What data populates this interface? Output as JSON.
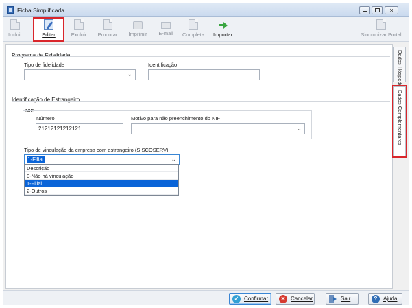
{
  "window": {
    "title": "Ficha Simplificada"
  },
  "toolbar": {
    "incluir": "Incluir",
    "editar": "Editar",
    "excluir": "Excluir",
    "procurar": "Procurar",
    "imprimir": "Imprimir",
    "email": "E-mail",
    "completa": "Completa",
    "importar": "Importar",
    "sincronizar": "Sincronizar Portal"
  },
  "fidelidade": {
    "title": "Programa de Fidelidade",
    "tipo_label": "Tipo de fidelidade",
    "tipo_value": "",
    "identificacao_label": "Identificação",
    "identificacao_value": ""
  },
  "estrangeiro": {
    "title": "Identificação de Estrangeiro",
    "nif_group": "NIF",
    "numero_label": "Número",
    "numero_value": "21212121212121",
    "motivo_label": "Motivo para não preenchimento do NIF",
    "motivo_value": "",
    "vinculacao_label": "Tipo de vinculação da empresa com estrangeiro (SISCOSERV)",
    "vinculacao_value": "1-Filial",
    "options": [
      "Descrição",
      "0-Não há vinculação",
      "1-Filial",
      "2-Outros"
    ],
    "selected_index": 2
  },
  "side_tabs": [
    "Dados Hóspede",
    "Dados Complementares"
  ],
  "buttons": {
    "confirmar": "Confirmar",
    "cancelar": "Cancelar",
    "sair": "Sair",
    "ajuda": "Ajuda"
  },
  "colors": {
    "highlight": "#d9262b",
    "selection": "#0a64d8"
  }
}
